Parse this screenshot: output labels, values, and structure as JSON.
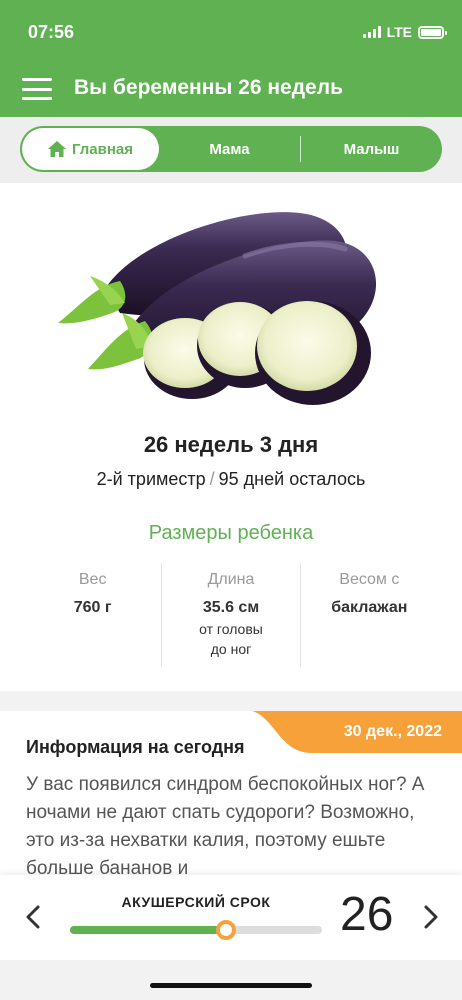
{
  "status_bar": {
    "time": "07:56",
    "network": "LTE"
  },
  "header": {
    "title": "Вы беременны 26 недель"
  },
  "tabs": [
    {
      "label": "Главная",
      "active": true,
      "icon": "home-icon"
    },
    {
      "label": "Мама",
      "active": false
    },
    {
      "label": "Малыш",
      "active": false
    }
  ],
  "summary": {
    "image": "eggplant",
    "weeks_days": "26 недель 3 дня",
    "trimester": "2-й триместр",
    "separator": "/",
    "days_left": "95 дней осталось"
  },
  "baby_size": {
    "title": "Размеры ребенка",
    "weight": {
      "label": "Вес",
      "value": "760 г"
    },
    "length": {
      "label": "Длина",
      "value": "35.6 см",
      "note_line1": "от головы",
      "note_line2": "до ног"
    },
    "comparison": {
      "label": "Весом с",
      "value": "баклажан"
    }
  },
  "info": {
    "date": "30 дек., 2022",
    "title": "Информация на сегодня",
    "body": "У вас появился синдром беспокойных ног? А ночами не дают спать судороги? Возможно, это из-за нехватки калия, поэтому ешьте больше бананов и"
  },
  "term_bar": {
    "label": "АКУШЕРСКИЙ СРОК",
    "week": "26",
    "progress_fraction": 0.62
  },
  "colors": {
    "primary_green": "#5fb152",
    "accent_orange": "#f7a13a",
    "text_dark": "#222222",
    "text_muted": "#999999"
  }
}
